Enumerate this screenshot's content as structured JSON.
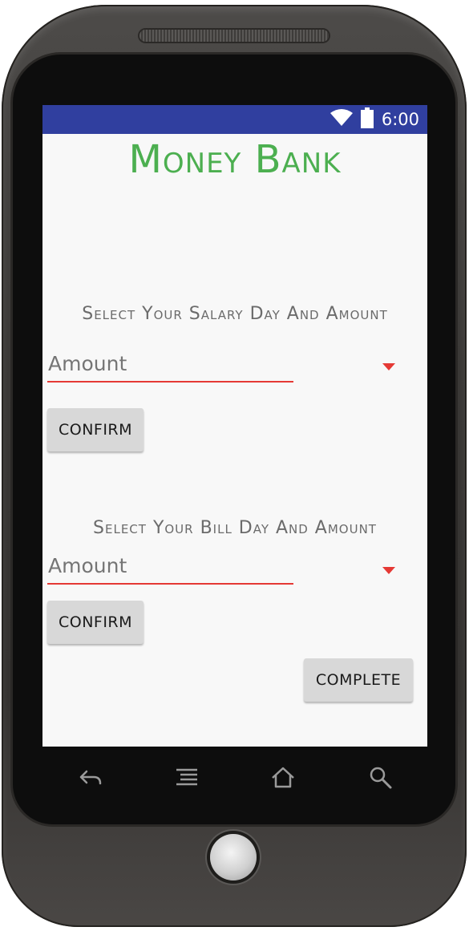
{
  "status_bar": {
    "time": "6:00",
    "icons": [
      "wifi-icon",
      "battery-icon"
    ],
    "color": "#303f9f"
  },
  "app": {
    "title": "Money Bank",
    "title_color": "#4caf50"
  },
  "salary_section": {
    "label": "Select Your Salary Day And Amount",
    "spinner_value": "Amount",
    "confirm_label": "CONFIRM"
  },
  "bill_section": {
    "label": "Select Your Bill Day And Amount",
    "spinner_value": "Amount",
    "confirm_label": "CONFIRM"
  },
  "complete_label": "COMPLETE",
  "nav_bar": {
    "icons": [
      "back-icon",
      "menu-icon",
      "home-icon",
      "search-icon"
    ]
  },
  "colors": {
    "accent": "#e53935",
    "button_bg": "#d8d8d8",
    "screen_bg": "#f8f8f8"
  }
}
